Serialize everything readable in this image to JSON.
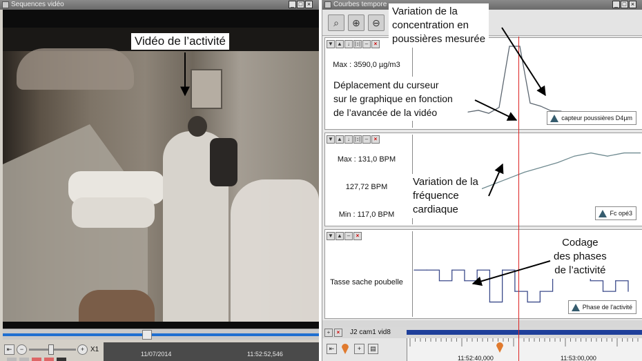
{
  "left_window": {
    "title": "Sequences vidéo",
    "controls": {
      "speed": "X1",
      "date": "11/07/2014",
      "time": "11:52:52,546",
      "zoom_out": "−",
      "zoom_in": "+"
    },
    "scrub_progress": 0.45
  },
  "right_window": {
    "title": "Courbes tempore",
    "panels": [
      {
        "labels": [
          "Max : 3590,0 µg/m3"
        ],
        "legend": "capteur poussières D4µm"
      },
      {
        "labels": [
          "Max : 131,0 BPM",
          "127,72 BPM",
          "Min : 117,0 BPM"
        ],
        "legend": "Fc opé3"
      },
      {
        "labels": [
          "Tasse sache poubelle"
        ],
        "legend": "Phase de l'activité"
      }
    ],
    "timeline": {
      "track_name": "J2 cam1 vid8",
      "tick_labels": [
        "11:52:40,000",
        "11:53:00,000"
      ]
    }
  },
  "annotations": {
    "video": "Vidéo de l’activité",
    "dust": [
      "Variation de la",
      "concentration en",
      "poussières mesurée"
    ],
    "cursor": [
      "Déplacement du curseur",
      "sur le graphique en fonction",
      "de l’avancée de la vidéo"
    ],
    "heart": [
      "Variation de la",
      "fréquence",
      "cardiaque"
    ],
    "phases": [
      "Codage",
      "des phases",
      "de l’activité"
    ]
  },
  "colors": {
    "cursor": "#d22222",
    "curve_dust": "#5c6670",
    "curve_heart": "#6f8a90",
    "curve_phase": "#3b4a8a",
    "timeline_bar": "#1f3f9a",
    "marker": "#e07a2e"
  },
  "chart_data": [
    {
      "type": "line",
      "name": "dust concentration",
      "legend": "capteur poussières D4µm",
      "y_max_label": "Max : 3590,0 µg/m3",
      "values": [
        480,
        560,
        420,
        700,
        3590,
        3590,
        900,
        760,
        540,
        520
      ]
    },
    {
      "type": "line",
      "name": "heart rate",
      "legend": "Fc opé3",
      "y_max_label": "Max : 131,0 BPM",
      "y_min_label": "Min : 117,0 BPM",
      "current_label": "127,72 BPM",
      "ylim": [
        117,
        131
      ],
      "values": [
        119,
        121,
        123,
        125,
        126.5,
        128,
        130,
        131,
        130,
        131,
        131
      ]
    },
    {
      "type": "line",
      "name": "activity phases",
      "legend": "Phase de l'activité",
      "y_label": "Tasse sache poubelle",
      "values": [
        4,
        4,
        3,
        4,
        3,
        4,
        1,
        4,
        2,
        1,
        2,
        5,
        6,
        4,
        3,
        2,
        3,
        2
      ]
    }
  ]
}
